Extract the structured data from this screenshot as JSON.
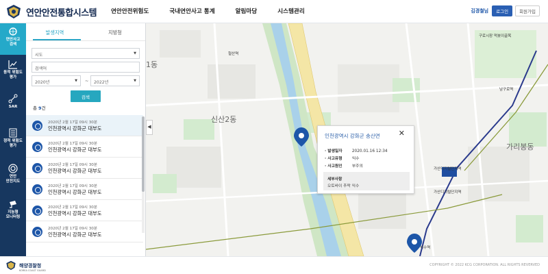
{
  "header": {
    "app_title": "연안안전통합시스템",
    "nav": [
      "연안안전위험도",
      "국내연안사고 통계",
      "알림마당",
      "시스템관리"
    ],
    "user_name": "김경철님",
    "login_label": "로그인",
    "join_label": "회원가입"
  },
  "rail": {
    "items": [
      {
        "label1": "연안사고",
        "label2": "검색",
        "icon": "search-icon"
      },
      {
        "label1": "동적 위험도",
        "label2": "평가",
        "icon": "chart-line-icon"
      },
      {
        "label1": "SAR",
        "label2": "",
        "icon": "sar-icon"
      },
      {
        "label1": "정적 위험도",
        "label2": "평가",
        "icon": "document-list-icon"
      },
      {
        "label1": "연안",
        "label2": "안전지도",
        "icon": "lifebuoy-icon"
      },
      {
        "label1": "지능형",
        "label2": "모니터링",
        "icon": "cctv-icon"
      }
    ]
  },
  "panel": {
    "tab_active": "발생지역",
    "tab_other": "지방청",
    "region_select": "시도",
    "search_placeholder": "검색어",
    "year_from": "2020년",
    "year_to": "2022년",
    "tilde": "~",
    "search_button": "검색",
    "total_prefix": "총 ",
    "total_count": "9",
    "total_suffix": "건",
    "items": [
      {
        "date": "2020년 2월 17일 09시 30분",
        "place": "인천광역시 강화군 대부도"
      },
      {
        "date": "2020년 2월 17일 09시 30분",
        "place": "인천광역시 강화군 대부도"
      },
      {
        "date": "2020년 2월 17일 09시 30분",
        "place": "인천광역시 강화군 대부도"
      },
      {
        "date": "2020년 2월 17일 09시 30분",
        "place": "인천광역시 강화군 대부도"
      },
      {
        "date": "2020년 2월 17일 09시 30분",
        "place": "인천광역시 강화군 대부도"
      },
      {
        "date": "2020년 2월 17일 09시 30분",
        "place": "인천광역시 강화군 대부도"
      }
    ]
  },
  "map": {
    "big_labels": [
      "1동",
      "신산2동",
      "가리봉동"
    ],
    "small_labels": [
      "구로시장 먹봇이골목",
      "가산디지털단지역",
      "가산디지털단지역",
      "남구로역",
      "철산역",
      "석수역"
    ],
    "popup": {
      "title": "인천광역시 강화군 송산면",
      "rows": [
        {
          "key": "발생일자",
          "value": "2020.01.16 12:34"
        },
        {
          "key": "사고유형",
          "value": "익수"
        },
        {
          "key": "사고원인",
          "value": "부주의"
        }
      ],
      "detail_title": "세부사항",
      "detail_value": "오토바이 추락 익수"
    }
  },
  "footer": {
    "org": "해양경찰청",
    "org_en": "KOREA COAST GUARD",
    "copyright": "COPYRIGHT © 2022 KCG CORPORATION. ALL RIGHTS REVERVED"
  },
  "colors": {
    "navy": "#17375f",
    "accent": "#25a9c9",
    "link_blue": "#2b5fa8"
  }
}
